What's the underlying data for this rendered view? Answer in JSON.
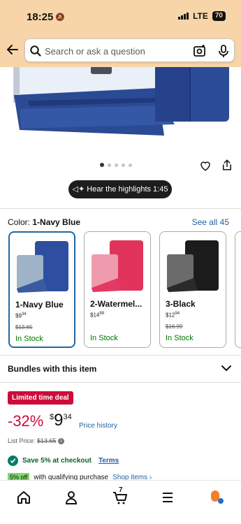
{
  "status": {
    "time": "18:25",
    "network": "LTE",
    "battery": "70"
  },
  "search": {
    "placeholder": "Search or ask a question"
  },
  "gallery": {
    "highlights": "Hear the highlights 1:45",
    "dots": 5
  },
  "color": {
    "label": "Color:",
    "selected": "1-Navy Blue",
    "see_all": "See all 45"
  },
  "swatches": [
    {
      "name": "1-Navy Blue",
      "price_dollars": "9",
      "price_cents": "34",
      "list": "$13.65",
      "stock": "In Stock",
      "color": "#3b5aa0"
    },
    {
      "name": "2-Watermel...",
      "price_dollars": "14",
      "price_cents": "99",
      "list": "",
      "stock": "In Stock",
      "color": "#e23a62"
    },
    {
      "name": "3-Black",
      "price_dollars": "12",
      "price_cents": "94",
      "list": "$16.99",
      "stock": "In Stock",
      "color": "#1c1c1c"
    }
  ],
  "peek_text": "-",
  "bundles": {
    "label": "Bundles with this item"
  },
  "deal": {
    "badge": "Limited time deal",
    "discount": "-32%",
    "currency": "$",
    "dollars": "9",
    "cents": "34",
    "price_history": "Price history",
    "list_label": "List Price:",
    "list_price": "$13.65"
  },
  "promo": {
    "save": "Save 5% at checkout",
    "terms": "Terms",
    "badge": "5% off",
    "qualifying": "with qualifying purchase",
    "shop": "Shop items ›"
  },
  "colors": {
    "accent": "#2162a1",
    "deal_red": "#cc0c39",
    "header": "#f8d5a8",
    "green": "#007600"
  },
  "tabs": [
    "home-icon",
    "account-icon",
    "cart-icon",
    "menu-icon",
    "rufus-icon"
  ],
  "cart_count": "7"
}
